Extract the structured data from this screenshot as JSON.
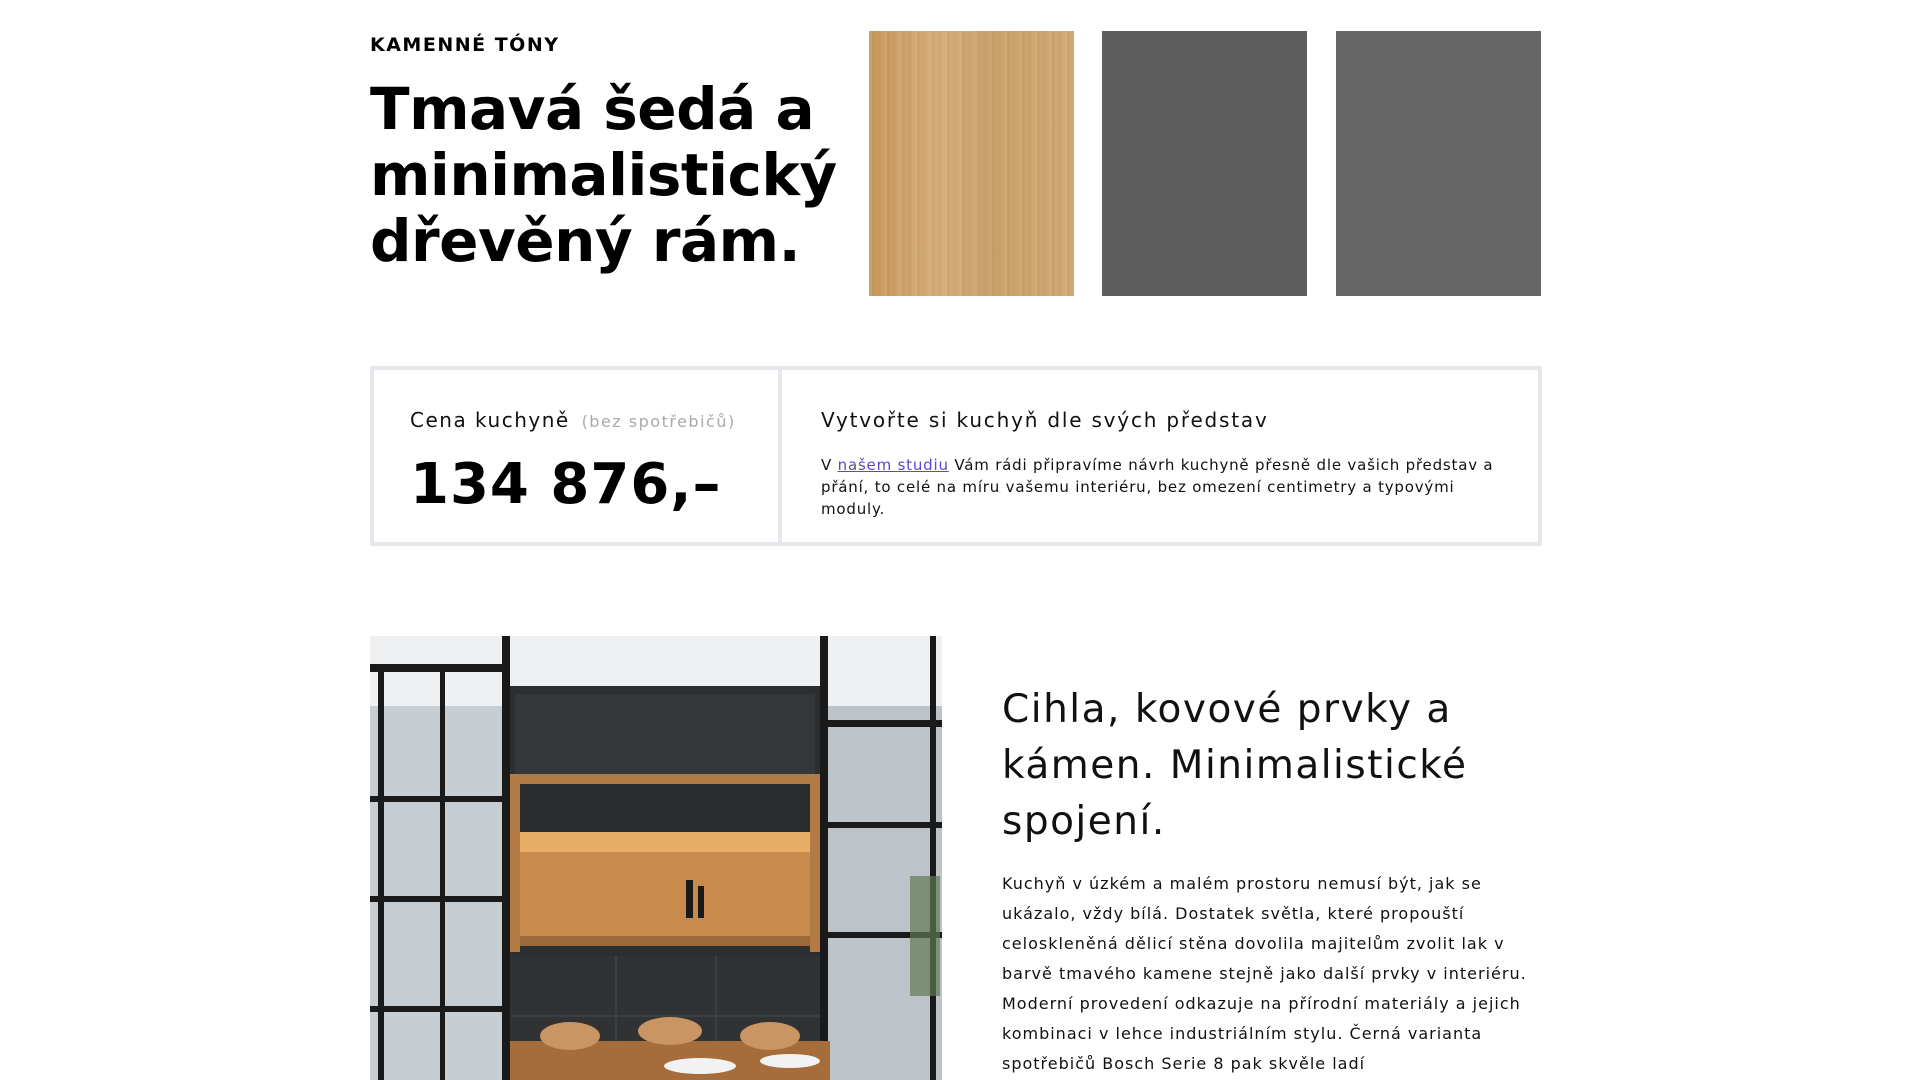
{
  "section": {
    "eyebrow": "KAMENNÉ TÓNY",
    "headline": "Tmavá šedá a minimalistický dřevěný rám."
  },
  "swatches": [
    {
      "color": "#cfa470",
      "texture": "wood"
    },
    {
      "color": "#5e5d5e"
    },
    {
      "color": "#656566"
    }
  ],
  "price": {
    "label": "Cena kuchyně",
    "note": "(bez spotřebičů)",
    "value": "134 876,–"
  },
  "info": {
    "title": "Vytvořte si kuchyň dle svých představ",
    "text_before": "V ",
    "link": "našem studiu",
    "text_after": " Vám rádi připravíme návrh kuchyně přesně dle vašich představ a přání, to celé na míru vašemu interiéru, bez omezení centimetry a typovými moduly."
  },
  "feature": {
    "heading": "Cihla, kovové prvky a kámen. Minimalistické spojení.",
    "body": "Kuchyň v úzkém a malém prostoru nemusí být, jak se ukázalo, vždy bílá. Dostatek světla, které propouští celoskleněná dělicí stěna dovolila majitelům zvolit lak v barvě tmavého kamene stejně jako další prvky v interiéru. Moderní provedení odkazuje na přírodní materiály a jejich kombinaci v lehce industriálním stylu. Černá varianta spotřebičů Bosch Serie 8 pak skvěle ladí"
  }
}
